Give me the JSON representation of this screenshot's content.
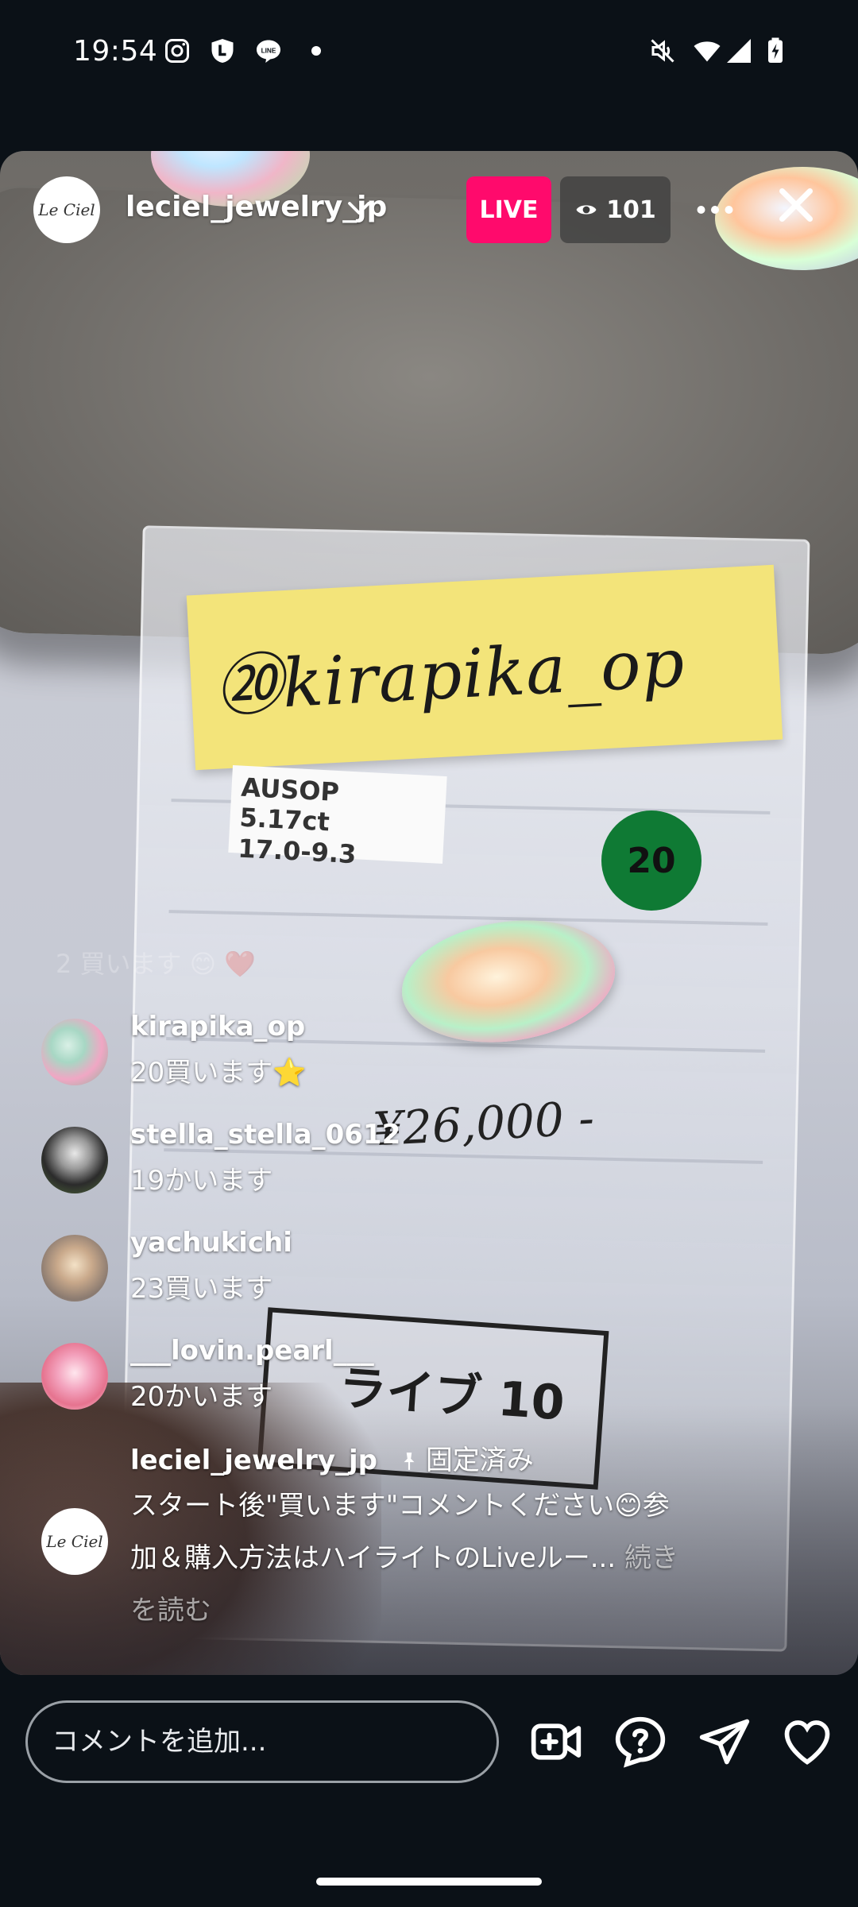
{
  "status_bar": {
    "time": "19:54",
    "icons_left": [
      "instagram-icon",
      "shield-l-icon",
      "line-icon",
      "dot-icon"
    ],
    "icons_right": [
      "mute-icon",
      "wifi-icon",
      "signal-icon",
      "battery-charging-icon"
    ]
  },
  "header": {
    "host_avatar_text": "Le Ciel",
    "host_name": "leciel_jewelry_jp",
    "live_label": "LIVE",
    "viewer_count": "101"
  },
  "video_scene": {
    "sticky_note": "⑳kirapika_op",
    "tag_line1": "AUSOP 5.17ct",
    "tag_line2": "17.0-9.3",
    "number_sticker": "20",
    "price": "¥26,000 -",
    "card_text": "ライブ 10"
  },
  "comments": {
    "faded": "2 買います 😊 ❤️",
    "items": [
      {
        "user": "kirapika_op",
        "text": "20買います⭐"
      },
      {
        "user": "stella_stella_0612",
        "text": "19かいます"
      },
      {
        "user": "yachukichi",
        "text": "23買います"
      },
      {
        "user": "___lovin.pearl___",
        "text": "20かいます"
      }
    ]
  },
  "pinned": {
    "user": "leciel_jewelry_jp",
    "pinned_label": "固定済み",
    "avatar_text": "Le Ciel",
    "body_line1": "スタート後\"買います\"コメントください😊参",
    "body_line2": "加＆購入方法はハイライトのLiveルー...",
    "more_part1": "続き",
    "more_part2": "を読む"
  },
  "bottom_bar": {
    "comment_placeholder": "コメントを追加..."
  },
  "colors": {
    "live_badge": "#ff0a6c",
    "background": "#0b1117"
  }
}
